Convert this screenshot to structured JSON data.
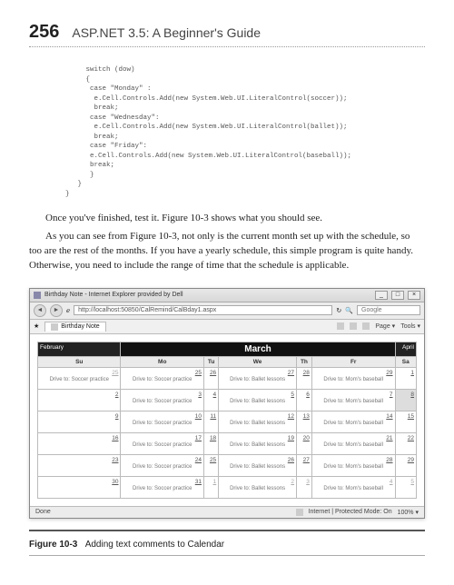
{
  "header": {
    "page_number": "256",
    "book_title": "ASP.NET 3.5: A Beginner's Guide"
  },
  "code": "     switch (dow)\n     {\n      case \"Monday\" :\n       e.Cell.Controls.Add(new System.Web.UI.LiteralControl(soccer));\n       break;\n      case \"Wednesday\":\n       e.Cell.Controls.Add(new System.Web.UI.LiteralControl(ballet));\n       break;\n      case \"Friday\":\n      e.Cell.Controls.Add(new System.Web.UI.LiteralControl(baseball));\n      break;\n      }\n   }\n}",
  "body": {
    "p1": "Once you've finished, test it. Figure 10-3 shows what you should see.",
    "p2": "As you can see from Figure 10-3, not only is the current month set up with the schedule, so too are the rest of the months. If you have a yearly schedule, this simple program is quite handy. Otherwise, you need to include the range of time that the schedule is applicable."
  },
  "browser": {
    "title": "Birthday Note - Internet Explorer provided by Dell",
    "min": "_",
    "max": "□",
    "close": "×",
    "back": "◄",
    "forward": "►",
    "address_prefix": "ℯ",
    "address": "http://localhost:50850/CalRemind/CalBday1.aspx",
    "refresh": "↻",
    "search_placeholder": "Google",
    "search_icon": "🔍",
    "fav_icon": "★",
    "tab_label": "Birthday Note",
    "tools": {
      "home": "Home",
      "rss": "RSS",
      "print": "Print",
      "page": "Page ▾",
      "tools_menu": "Tools ▾"
    },
    "status_left": "Done",
    "status_mid": "Internet | Protected Mode: On",
    "status_zoom": "100% ▾"
  },
  "calendar": {
    "prev_month": "February",
    "month": "March",
    "next_month": "April",
    "daynames": [
      "Su",
      "Mo",
      "Tu",
      "We",
      "Th",
      "Fr",
      "Sa"
    ],
    "events": {
      "Monday": "Drive to:\nSoccer practice",
      "Wednesday": "Drive to:\nBallet lessons",
      "Friday": "Drive to:\nMom's baseball"
    },
    "rows": [
      [
        {
          "n": "25",
          "other": true,
          "ev": "Monday_prev"
        },
        {
          "n": "25",
          "ev": "Monday"
        },
        {
          "n": "26"
        },
        {
          "n": "27",
          "ev": "Wednesday"
        },
        {
          "n": "28"
        },
        {
          "n": "29",
          "ev": "Friday"
        },
        {
          "n": "1"
        }
      ],
      [
        {
          "n": "2"
        },
        {
          "n": "3",
          "ev": "Monday"
        },
        {
          "n": "4"
        },
        {
          "n": "5",
          "ev": "Wednesday"
        },
        {
          "n": "6"
        },
        {
          "n": "7",
          "ev": "Friday"
        },
        {
          "n": "8",
          "today": true
        }
      ],
      [
        {
          "n": "9"
        },
        {
          "n": "10",
          "ev": "Monday"
        },
        {
          "n": "11"
        },
        {
          "n": "12",
          "ev": "Wednesday"
        },
        {
          "n": "13"
        },
        {
          "n": "14",
          "ev": "Friday"
        },
        {
          "n": "15"
        }
      ],
      [
        {
          "n": "16"
        },
        {
          "n": "17",
          "ev": "Monday"
        },
        {
          "n": "18"
        },
        {
          "n": "19",
          "ev": "Wednesday"
        },
        {
          "n": "20"
        },
        {
          "n": "21",
          "ev": "Friday"
        },
        {
          "n": "22"
        }
      ],
      [
        {
          "n": "23"
        },
        {
          "n": "24",
          "ev": "Monday"
        },
        {
          "n": "25"
        },
        {
          "n": "26",
          "ev": "Wednesday"
        },
        {
          "n": "27"
        },
        {
          "n": "28",
          "ev": "Friday"
        },
        {
          "n": "29"
        }
      ],
      [
        {
          "n": "30"
        },
        {
          "n": "31",
          "ev": "Monday"
        },
        {
          "n": "1",
          "other": true
        },
        {
          "n": "2",
          "other": true,
          "ev": "Wednesday"
        },
        {
          "n": "3",
          "other": true
        },
        {
          "n": "4",
          "other": true,
          "ev": "Friday"
        },
        {
          "n": "5",
          "other": true
        }
      ]
    ]
  },
  "caption": {
    "label": "Figure 10-3",
    "text": "Adding text comments to Calendar"
  }
}
